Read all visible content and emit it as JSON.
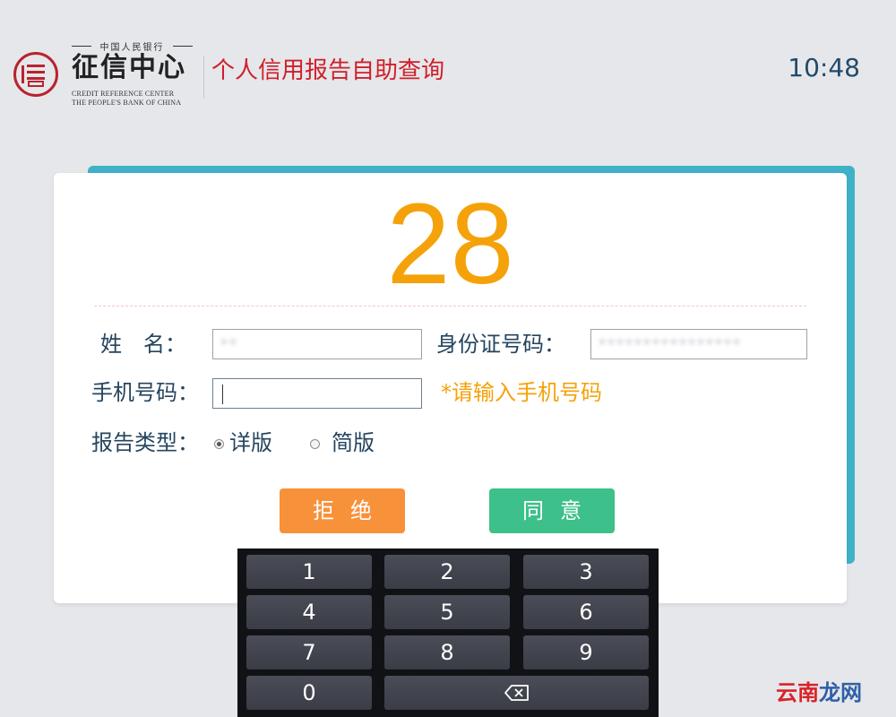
{
  "header": {
    "logo_top": "中国人民银行",
    "logo_main": "征信中心",
    "logo_en_line1": "CREDIT REFERENCE CENTER",
    "logo_en_line2": "THE PEOPLE'S BANK OF CHINA",
    "app_title": "个人信用报告自助查询",
    "clock": "10:48"
  },
  "form": {
    "countdown": "28",
    "name_label": "姓　名：",
    "name_value": "**",
    "id_label": "身份证号码：",
    "id_value": "****************",
    "phone_label": "手机号码：",
    "phone_value": "",
    "phone_hint": "*请输入手机号码",
    "report_type_label": "报告类型：",
    "report_options": [
      {
        "label": "详版",
        "checked": true
      },
      {
        "label": "简版",
        "checked": false
      }
    ],
    "reject_label": "拒绝",
    "agree_label": "同意"
  },
  "keypad": {
    "keys": [
      "1",
      "2",
      "3",
      "4",
      "5",
      "6",
      "7",
      "8",
      "9",
      "0"
    ],
    "backspace_icon": "backspace-icon"
  },
  "watermark": {
    "part_a": "云南",
    "part_b": "龙网"
  },
  "colors": {
    "brand_red": "#cf1f2a",
    "countdown": "#f5a20a",
    "accent_teal": "#3fb2c8",
    "reject": "#f7913a",
    "agree": "#3dc08a"
  }
}
